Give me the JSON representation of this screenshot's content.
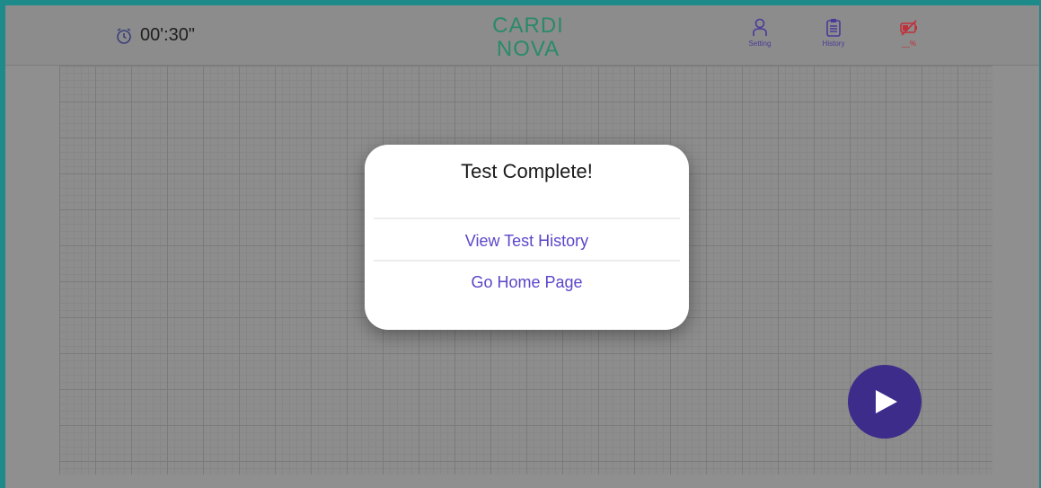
{
  "header": {
    "timer_value": "00':30\"",
    "logo_line1": "CARDI",
    "logo_line2": "NOVA",
    "nav": [
      {
        "label": "Setting",
        "icon": "person-icon"
      },
      {
        "label": "History",
        "icon": "clipboard-icon"
      },
      {
        "label": "__%",
        "icon": "battery-off-icon"
      }
    ]
  },
  "modal": {
    "title": "Test Complete!",
    "actions": [
      "View Test History",
      "Go Home Page"
    ]
  },
  "play_button": {
    "icon": "play-icon"
  },
  "colors": {
    "accent": "#5a46c9",
    "play_button": "#3d2c8a",
    "logo_green": "#2a8a6a",
    "battery_red": "#c0303a"
  }
}
